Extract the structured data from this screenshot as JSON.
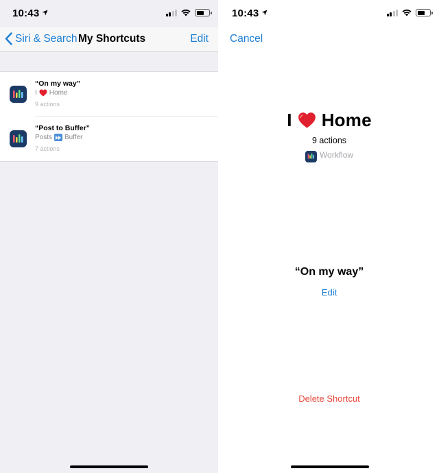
{
  "left": {
    "status": {
      "time": "10:43"
    },
    "nav": {
      "back_label": "Siri & Search",
      "title": "My Shortcuts",
      "right_label": "Edit"
    },
    "shortcuts": [
      {
        "title": "“On my way”",
        "sub_prefix": "I",
        "sub_suffix": "Home",
        "meta": "9 actions"
      },
      {
        "title": "“Post to Buffer”",
        "sub_prefix": "Posts",
        "sub_suffix": "Buffer",
        "meta": "7 actions"
      }
    ]
  },
  "right": {
    "status": {
      "time": "10:43"
    },
    "nav": {
      "left_label": "Cancel"
    },
    "detail": {
      "title_prefix": "I",
      "title_suffix": "Home",
      "actions": "9 actions",
      "app_name": "Workflow",
      "phrase": "“On my way”",
      "edit_label": "Edit",
      "delete_label": "Delete Shortcut"
    }
  },
  "colors": {
    "accent": "#1b7ed5",
    "destructive": "#e5483b",
    "grouped_background": "#efeff4",
    "app_icon": "#1c3a66",
    "heart": "#e0202c"
  },
  "icons": [
    "location-arrow-icon",
    "signal-icon",
    "wifi-icon",
    "battery-icon",
    "chevron-left-icon",
    "workflow-app-icon",
    "heart-icon",
    "fast-forward-icon"
  ]
}
